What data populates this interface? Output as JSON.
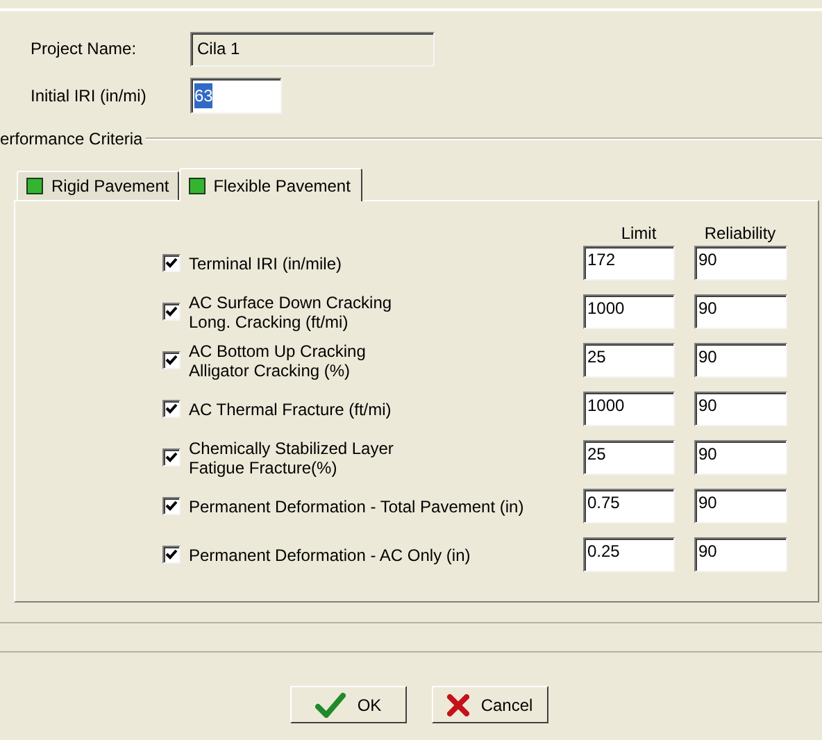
{
  "project_name": {
    "label": "Project Name:",
    "value": "Cila 1"
  },
  "initial_iri": {
    "label": "Initial IRI (in/mi)",
    "value": "63",
    "text_selected": true
  },
  "group": {
    "title": "erformance Criteria"
  },
  "tabs": [
    {
      "label": "Rigid Pavement",
      "selected": false
    },
    {
      "label": "Flexible Pavement",
      "selected": true
    }
  ],
  "columns": [
    "Limit",
    "Reliability"
  ],
  "criteria": [
    {
      "label": "Terminal IRI (in/mile)",
      "checked": true,
      "limit": "172",
      "reliability": "90"
    },
    {
      "label": "AC Surface Down Cracking\nLong. Cracking (ft/mi)",
      "checked": true,
      "limit": "1000",
      "reliability": "90"
    },
    {
      "label": "AC Bottom Up Cracking\nAlligator Cracking (%)",
      "checked": true,
      "limit": "25",
      "reliability": "90"
    },
    {
      "label": "AC Thermal Fracture (ft/mi)",
      "checked": true,
      "limit": "1000",
      "reliability": "90"
    },
    {
      "label": "Chemically Stabilized Layer\nFatigue Fracture(%)",
      "checked": true,
      "limit": "25",
      "reliability": "90"
    },
    {
      "label": "Permanent Deformation - Total Pavement (in)",
      "checked": true,
      "limit": "0.75",
      "reliability": "90"
    },
    {
      "label": "Permanent Deformation - AC Only (in)",
      "checked": true,
      "limit": "0.25",
      "reliability": "90"
    }
  ],
  "buttons": [
    {
      "label": "OK",
      "kind": "ok"
    },
    {
      "label": "Cancel",
      "kind": "cancel"
    }
  ]
}
